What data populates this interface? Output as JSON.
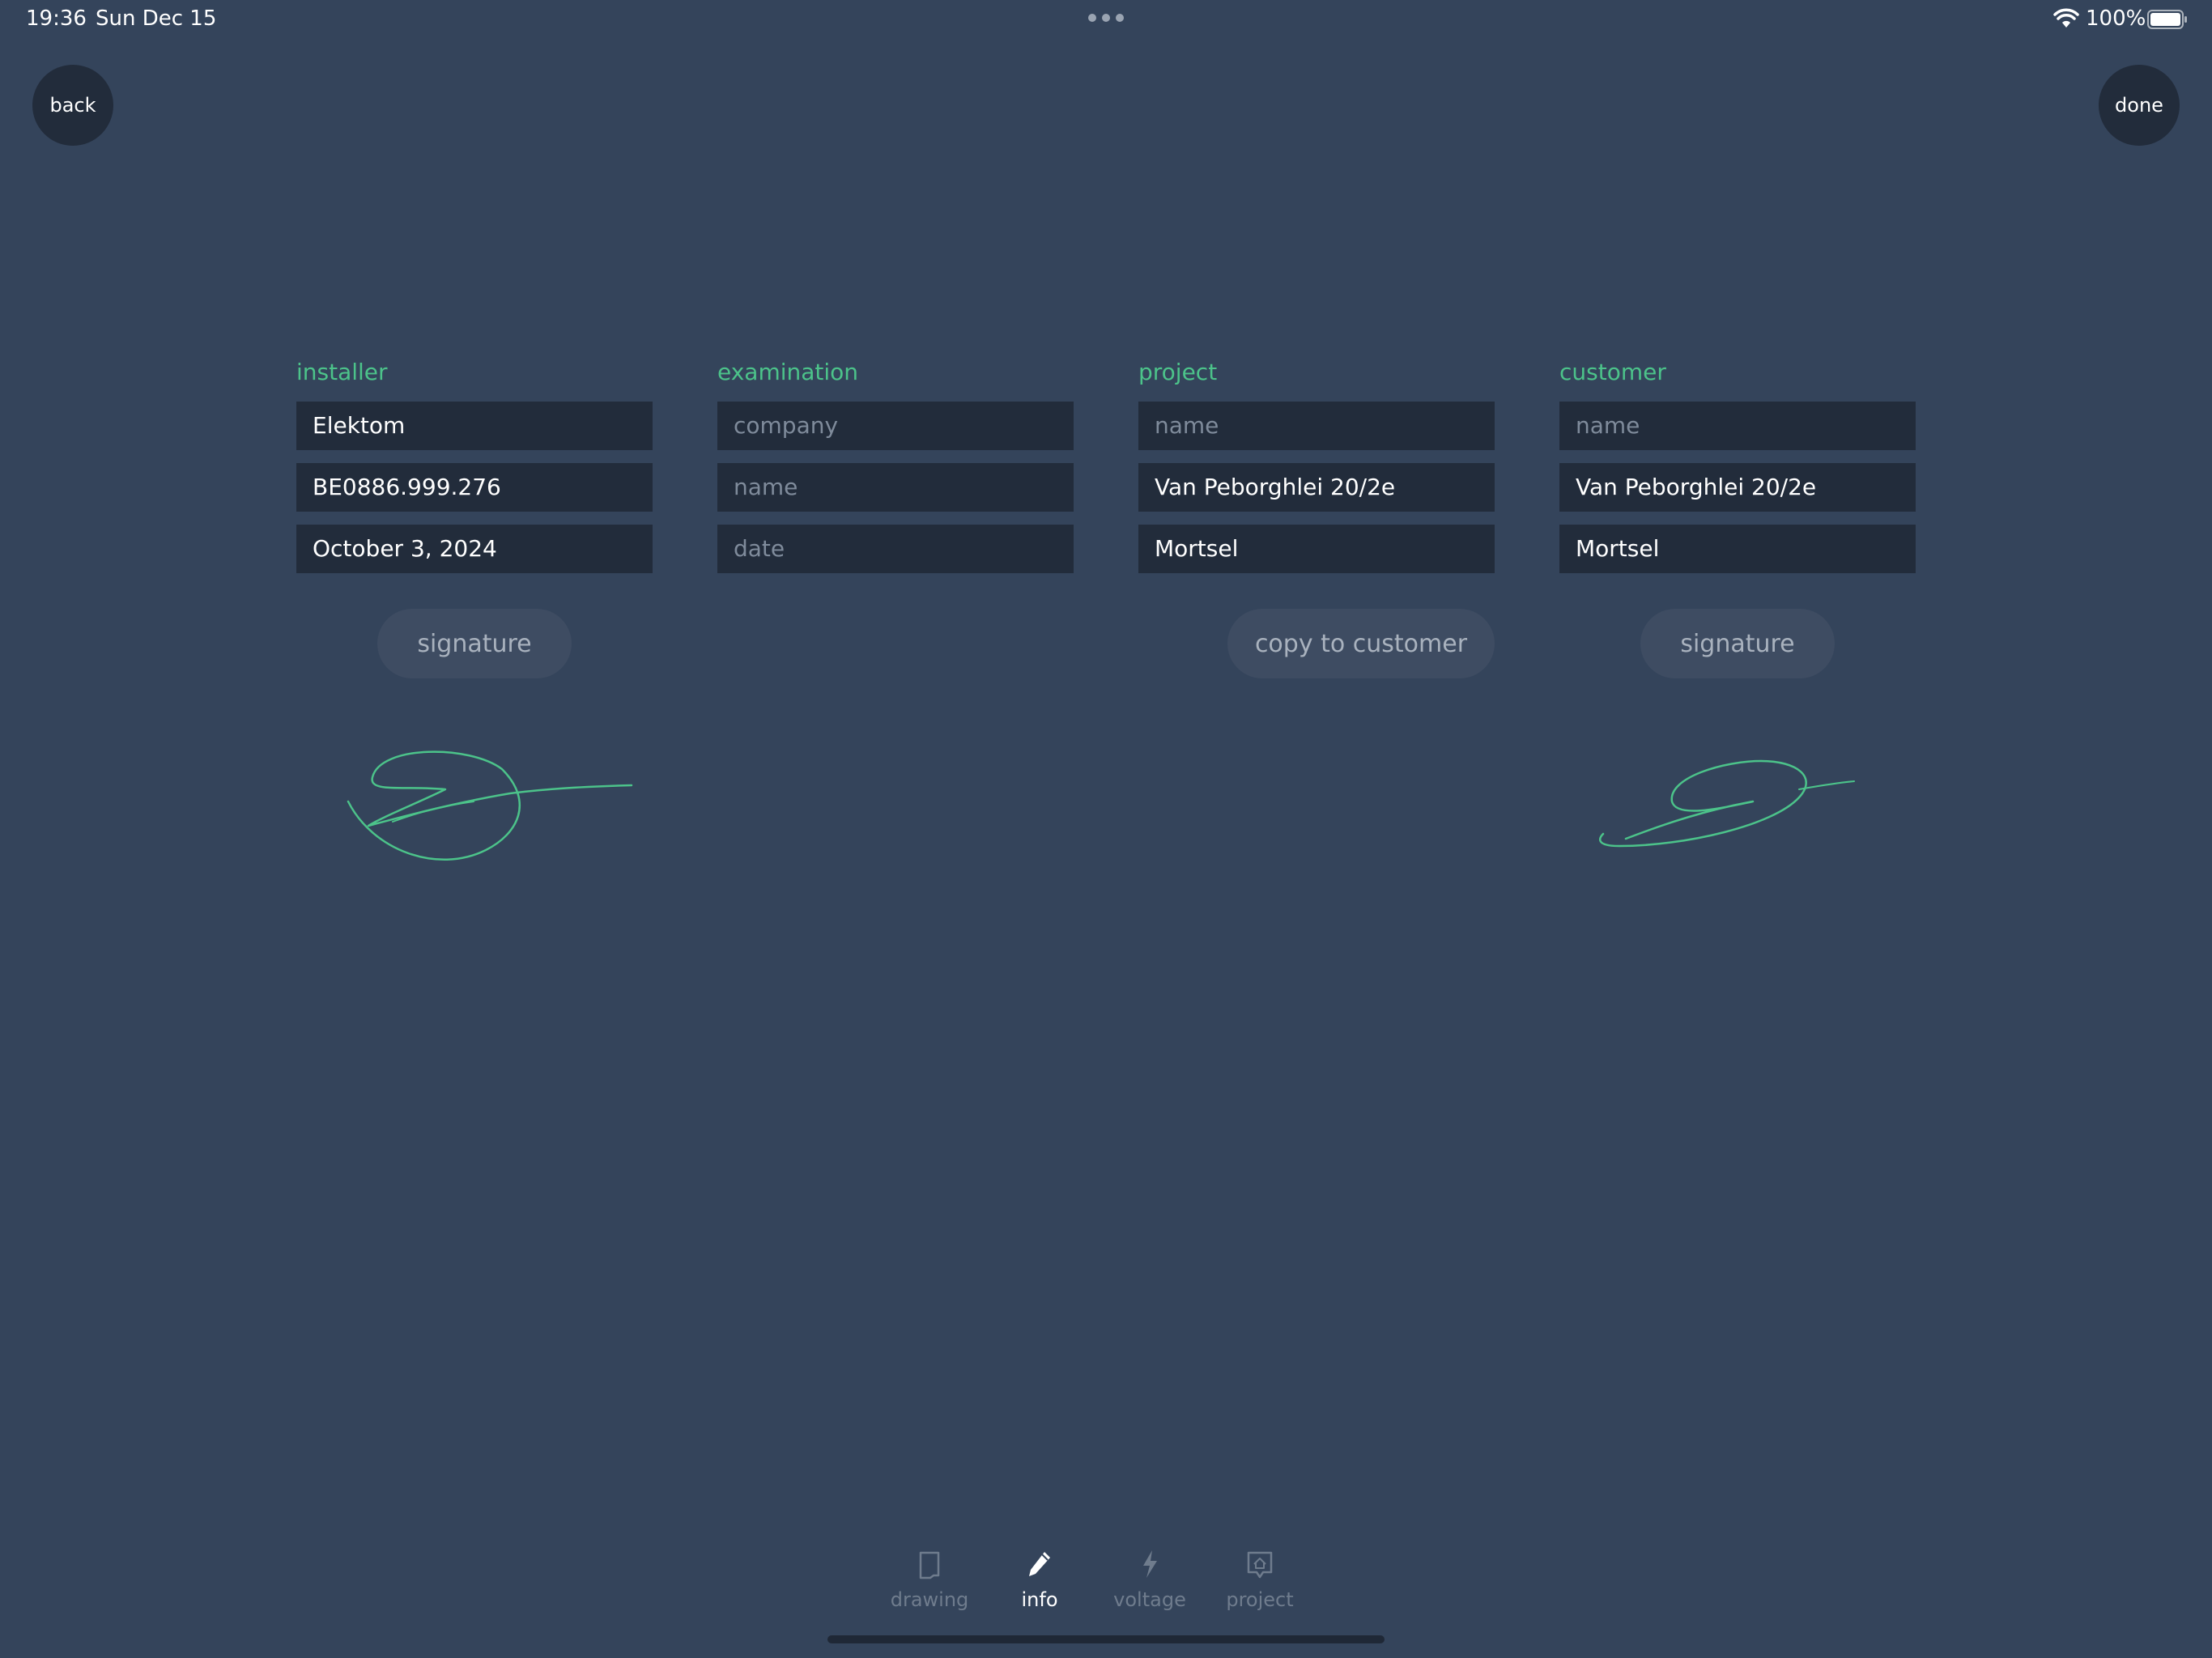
{
  "status_bar": {
    "time": "19:36",
    "date": "Sun Dec 15",
    "battery": "100%"
  },
  "nav": {
    "back_label": "back",
    "done_label": "done"
  },
  "installer": {
    "title": "installer",
    "company": "Elektom",
    "vat": "BE0886.999.276",
    "date": "October 3, 2024",
    "signature_label": "signature"
  },
  "examination": {
    "title": "examination",
    "company_placeholder": "company",
    "name_placeholder": "name",
    "date_placeholder": "date"
  },
  "project": {
    "title": "project",
    "name_placeholder": "name",
    "address": "Van Peborghlei 20/2e",
    "city": "Mortsel",
    "copy_label": "copy to customer"
  },
  "customer": {
    "title": "customer",
    "name_placeholder": "name",
    "address": "Van Peborghlei 20/2e",
    "city": "Mortsel",
    "signature_label": "signature"
  },
  "tabs": [
    {
      "label": "drawing",
      "icon": "tablet-icon",
      "active": false
    },
    {
      "label": "info",
      "icon": "pencil-icon",
      "active": true
    },
    {
      "label": "voltage",
      "icon": "lightning-icon",
      "active": false
    },
    {
      "label": "project",
      "icon": "house-icon",
      "active": false
    }
  ],
  "colors": {
    "background": "#34445b",
    "field": "#222c3b",
    "accent": "#4cc38a",
    "button": "#3e4c62"
  }
}
